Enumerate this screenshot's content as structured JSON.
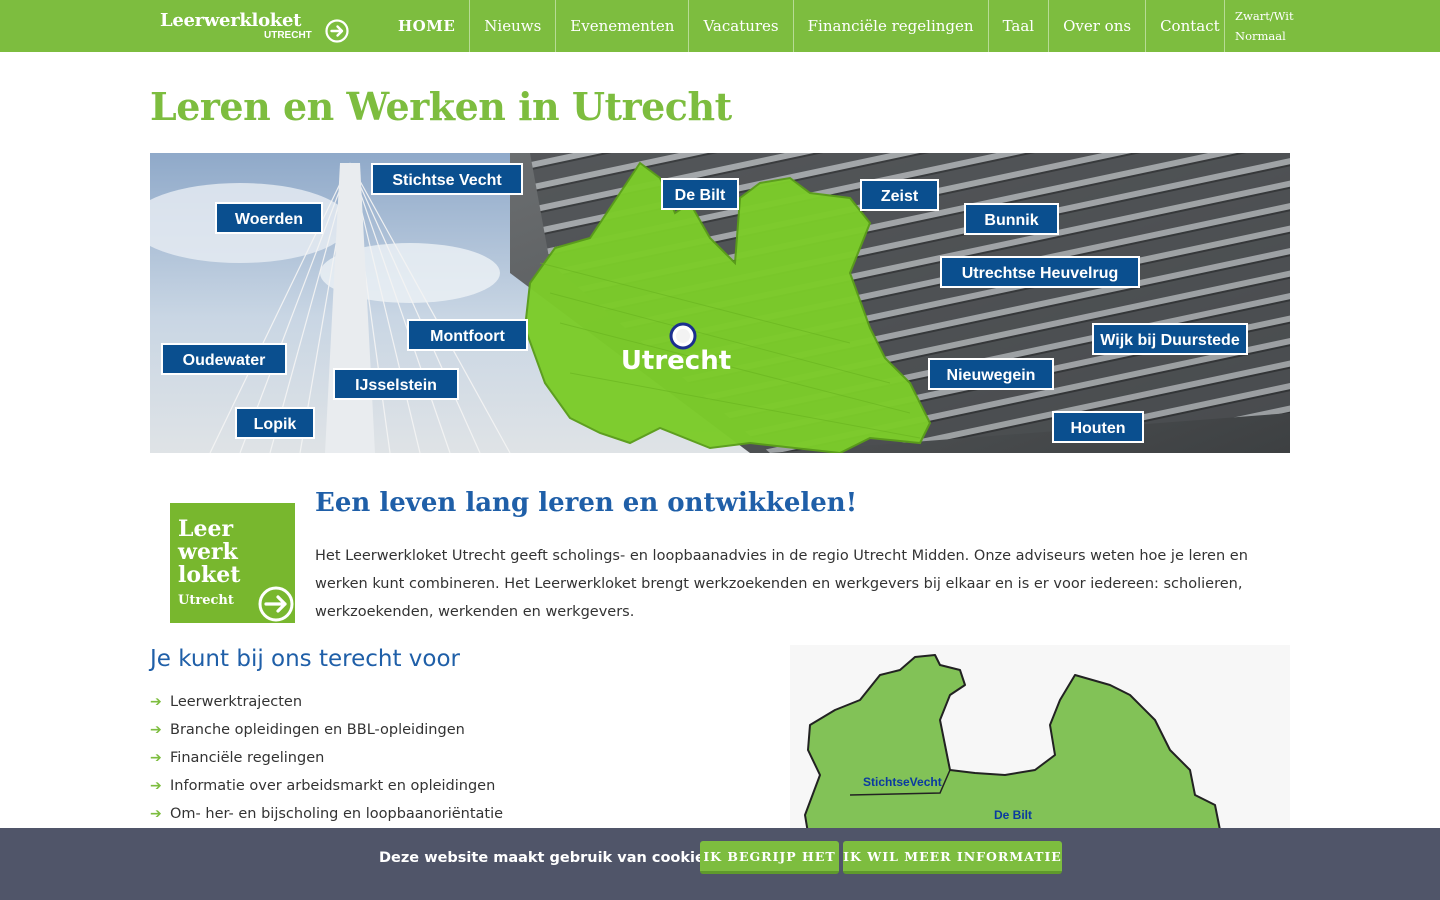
{
  "header": {
    "logo": {
      "title": "Leerwerkloket",
      "subtitle": "UTRECHT"
    },
    "nav": [
      "HOME",
      "Nieuws",
      "Evenementen",
      "Vacatures",
      "Financiële regelingen",
      "Taal",
      "Over ons",
      "Contact"
    ],
    "contrast": {
      "bw": "Zwart/Wit",
      "normal": "Normaal"
    }
  },
  "page": {
    "title": "Leren en Werken in Utrecht"
  },
  "banner": {
    "center_label": "Utrecht",
    "municipalities": [
      "Woerden",
      "Stichtse Vecht",
      "De Bilt",
      "Zeist",
      "Bunnik",
      "Utrechtse Heuvelrug",
      "Montfoort",
      "Oudewater",
      "IJsselstein",
      "Lopik",
      "Nieuwegein",
      "Wijk bij Duurstede",
      "Houten"
    ]
  },
  "intro": {
    "logo_lines": [
      "Leer",
      "werk",
      "loket",
      "Utrecht"
    ],
    "heading": "Een leven lang leren en ontwikkelen!",
    "text": "Het Leerwerkloket Utrecht geeft scholings- en loopbaanadvies in de regio Utrecht Midden. Onze adviseurs weten hoe je leren en werken kunt combineren. Het Leerwerkloket brengt werkzoekenden en werkgevers bij elkaar en is er voor iedereen: scholieren, werkzoekenden, werkenden en werkgevers."
  },
  "services": {
    "heading": "Je kunt bij ons terecht voor",
    "items": [
      "Leerwerktrajecten",
      "Branche opleidingen en BBL-opleidingen",
      "Financiële regelingen",
      "Informatie over arbeidsmarkt en opleidingen",
      "Om- her- en bijscholing en loopbaanoriëntatie"
    ]
  },
  "region_map": {
    "labels": [
      "StichtseVecht",
      "De Bilt"
    ]
  },
  "cookie": {
    "text": "Deze website maakt gebruik van cookies",
    "accept": "IK BEGRIJP HET",
    "more": "IK WIL MEER INFORMATIE"
  },
  "colors": {
    "brand_green": "#7dbd3f",
    "heading_blue": "#1f5fa8",
    "cookie_bg": "#505569",
    "label_blue": "#0a4f8f"
  }
}
